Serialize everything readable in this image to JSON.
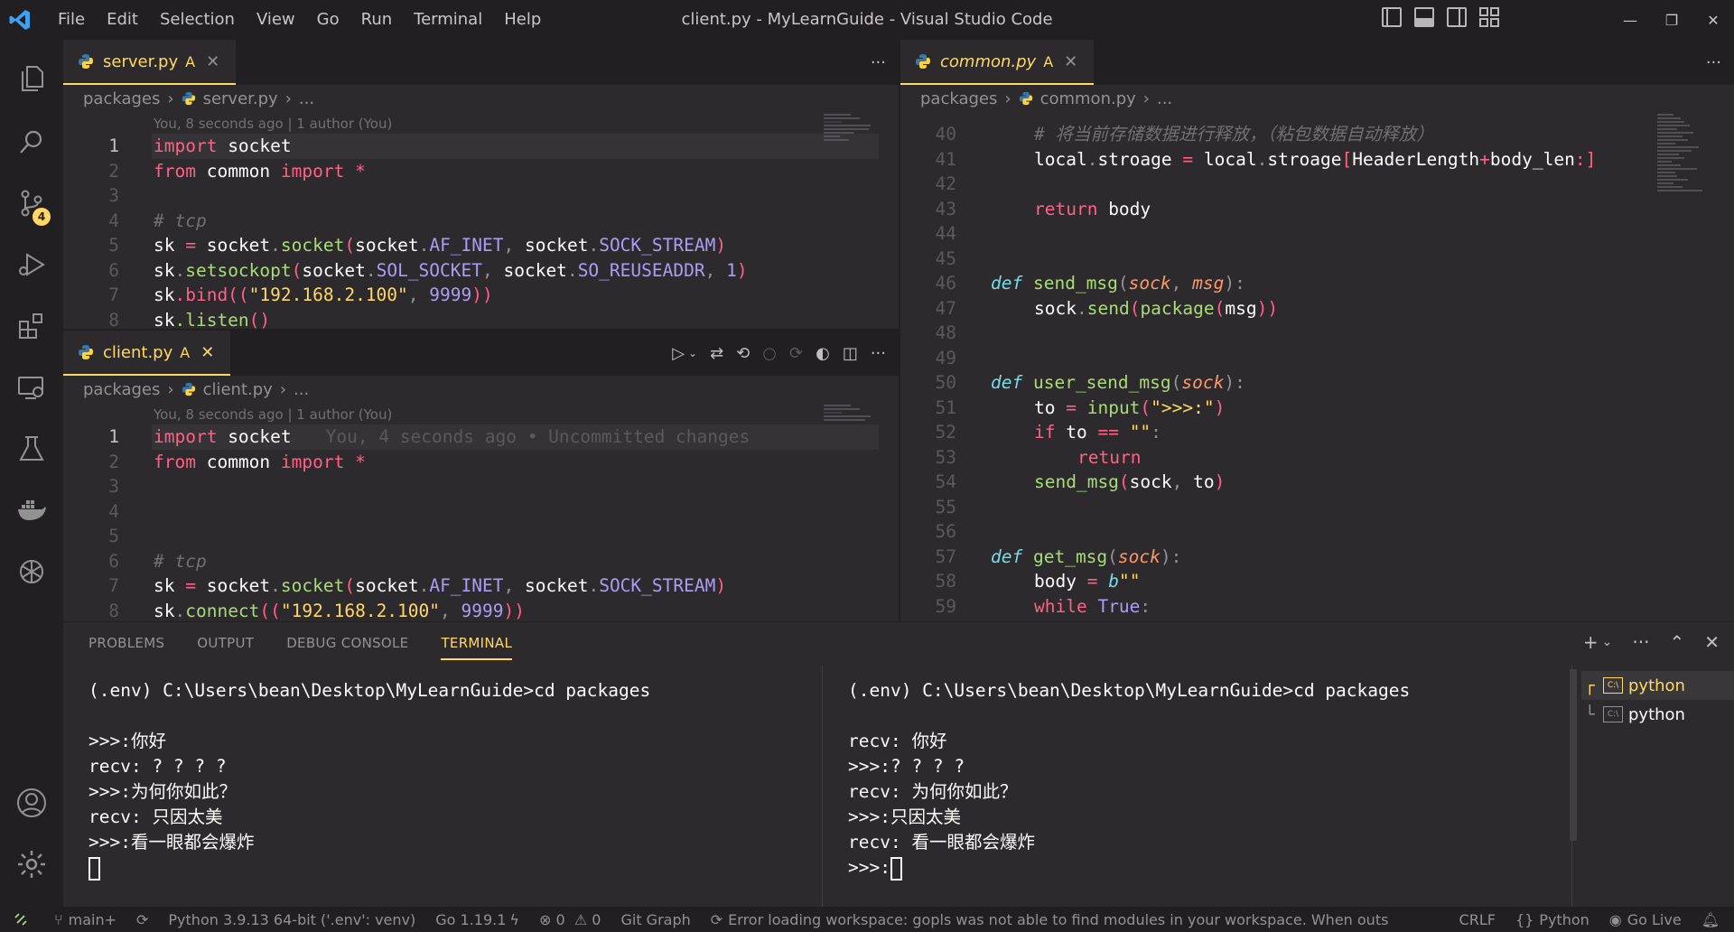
{
  "window": {
    "title": "client.py - MyLearnGuide - Visual Studio Code",
    "menu": [
      "File",
      "Edit",
      "Selection",
      "View",
      "Go",
      "Run",
      "Terminal",
      "Help"
    ]
  },
  "activity": {
    "scm_badge": "4"
  },
  "editors": {
    "server": {
      "tab_label": "server.py",
      "tab_mark": "A",
      "breadcrumb": [
        "packages",
        "server.py",
        "..."
      ],
      "blame": "You, 8 seconds ago | 1 author (You)",
      "lines": [
        {
          "n": "1"
        },
        {
          "n": "2"
        },
        {
          "n": "3"
        },
        {
          "n": "4"
        },
        {
          "n": "5"
        },
        {
          "n": "6"
        },
        {
          "n": "7"
        },
        {
          "n": "8"
        }
      ],
      "code": {
        "l1": {
          "kw": "import",
          "rest": " socket"
        },
        "l2": {
          "kw1": "from",
          "mod": " common ",
          "kw2": "import",
          "star": " *"
        },
        "l4": "# tcp",
        "l5": [
          "sk",
          " = ",
          "socket",
          ".",
          "socket",
          "(",
          "socket",
          ".",
          "AF_INET",
          ", ",
          "socket",
          ".",
          "SOCK_STREAM",
          ")"
        ],
        "l6": [
          "sk",
          ".",
          "setsockopt",
          "(",
          "socket",
          ".",
          "SOL_SOCKET",
          ", ",
          "socket",
          ".",
          "SO_REUSEADDR",
          ", ",
          "1",
          ")"
        ],
        "l7": [
          "sk",
          ".bind((",
          "\"192.168.2.100\"",
          ", ",
          "9999",
          "))"
        ],
        "l8": [
          "sk",
          ".listen",
          "()"
        ]
      }
    },
    "client": {
      "tab_label": "client.py",
      "tab_mark": "A",
      "breadcrumb": [
        "packages",
        "client.py",
        "..."
      ],
      "blame": "You, 8 seconds ago | 1 author (You)",
      "inline_blame": "You, 4 seconds ago • Uncommitted changes",
      "lines": [
        {
          "n": "1"
        },
        {
          "n": "2"
        },
        {
          "n": "3"
        },
        {
          "n": "4"
        },
        {
          "n": "5"
        },
        {
          "n": "6"
        },
        {
          "n": "7"
        },
        {
          "n": "8"
        }
      ],
      "code": {
        "l1": {
          "kw": "import",
          "rest": " socket"
        },
        "l2": {
          "kw1": "from",
          "mod": " common ",
          "kw2": "import",
          "star": " *"
        },
        "l6": "# tcp",
        "l7": [
          "sk",
          " = ",
          "socket",
          ".",
          "socket",
          "(",
          "socket",
          ".",
          "AF_INET",
          ", ",
          "socket",
          ".",
          "SOCK_STREAM",
          ")"
        ],
        "l8": [
          "sk",
          ".",
          "connect",
          "((",
          "\"192.168.2.100\"",
          ", ",
          "9999",
          "))"
        ]
      }
    },
    "common": {
      "tab_label": "common.py",
      "tab_mark": "A",
      "breadcrumb": [
        "packages",
        "common.py",
        "..."
      ],
      "line_numbers": [
        "40",
        "41",
        "42",
        "43",
        "44",
        "45",
        "46",
        "47",
        "48",
        "49",
        "50",
        "51",
        "52",
        "53",
        "54",
        "55",
        "56",
        "57",
        "58",
        "59"
      ],
      "code": {
        "l40": "# 将当前存储数据进行释放，（粘包数据自动释放）",
        "l41": [
          "local",
          ".",
          "stroage",
          " = ",
          "local",
          ".",
          "stroage",
          "[",
          "HeaderLength",
          "+",
          "body_len",
          ":",
          "]"
        ],
        "l43": [
          "return",
          " body"
        ],
        "l46": [
          "def",
          " ",
          "send_msg",
          "(",
          "sock",
          ", ",
          "msg",
          "):"
        ],
        "l47": [
          "sock",
          ".",
          "send",
          "(",
          "package",
          "(",
          "msg",
          "))"
        ],
        "l50": [
          "def",
          " ",
          "user_send_msg",
          "(",
          "sock",
          "):"
        ],
        "l51": [
          "to",
          " = ",
          "input",
          "(",
          "\">>>:\"",
          ")"
        ],
        "l52": [
          "if",
          " to ",
          "==",
          " ",
          "\"\"",
          ":"
        ],
        "l53": [
          "return"
        ],
        "l54": [
          "send_msg",
          "(",
          "sock",
          ", ",
          "to",
          ")"
        ],
        "l57": [
          "def",
          " ",
          "get_msg",
          "(",
          "sock",
          "):"
        ],
        "l58": [
          "body",
          " = ",
          "b",
          "\"\""
        ],
        "l59": [
          "while",
          " ",
          "True",
          ":"
        ]
      }
    }
  },
  "panel": {
    "tabs": [
      "PROBLEMS",
      "OUTPUT",
      "DEBUG CONSOLE",
      "TERMINAL"
    ],
    "terminal_left": [
      "(.env) C:\\Users\\bean\\Desktop\\MyLearnGuide>cd packages",
      "",
      ">>>:你好",
      "recv: ? ? ? ?",
      ">>>:为何你如此？",
      "recv: 只因太美",
      ">>>:看一眼都会爆炸"
    ],
    "terminal_right": [
      "(.env) C:\\Users\\bean\\Desktop\\MyLearnGuide>cd packages",
      "",
      "recv: 你好",
      ">>>:? ? ? ?",
      "recv: 为何你如此？",
      ">>>:只因太美",
      "recv: 看一眼都会爆炸",
      ">>>:"
    ],
    "terminals": [
      "python",
      "python"
    ]
  },
  "statusbar": {
    "branch": "main+",
    "python": "Python 3.9.13 64-bit ('.env': venv)",
    "go": "Go 1.19.1",
    "errors": "0",
    "warnings": "0",
    "git_graph": "Git Graph",
    "message": "Error loading workspace: gopls was not able to find modules in your workspace. When outside c",
    "eol": "CRLF",
    "language": "Python",
    "go_live": "Go Live"
  },
  "colors": {
    "accent": "#ffd866",
    "bg": "#2d2a2e",
    "chrome": "#221f22",
    "keyword": "#ff6188",
    "string": "#ffd866",
    "function": "#a9dc76",
    "number": "#ab9df2",
    "type": "#78dce8"
  }
}
